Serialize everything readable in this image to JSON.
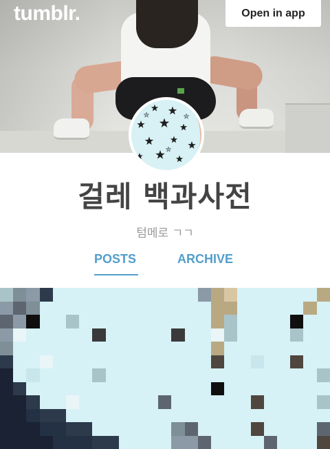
{
  "header": {
    "logo": "tumblr.",
    "open_app_label": "Open in app"
  },
  "blog": {
    "title": "걸레 백과사전",
    "description": "텀메로 ㄱㄱ"
  },
  "tabs": [
    {
      "label": "POSTS",
      "active": true
    },
    {
      "label": "ARCHIVE",
      "active": false
    }
  ],
  "colors": {
    "accent": "#529ecc",
    "title_text": "#444444",
    "subtitle_text": "#999999",
    "avatar_bg": "#d7f1f5"
  },
  "icons": {
    "avatar_pattern": "star-pattern-icon"
  }
}
